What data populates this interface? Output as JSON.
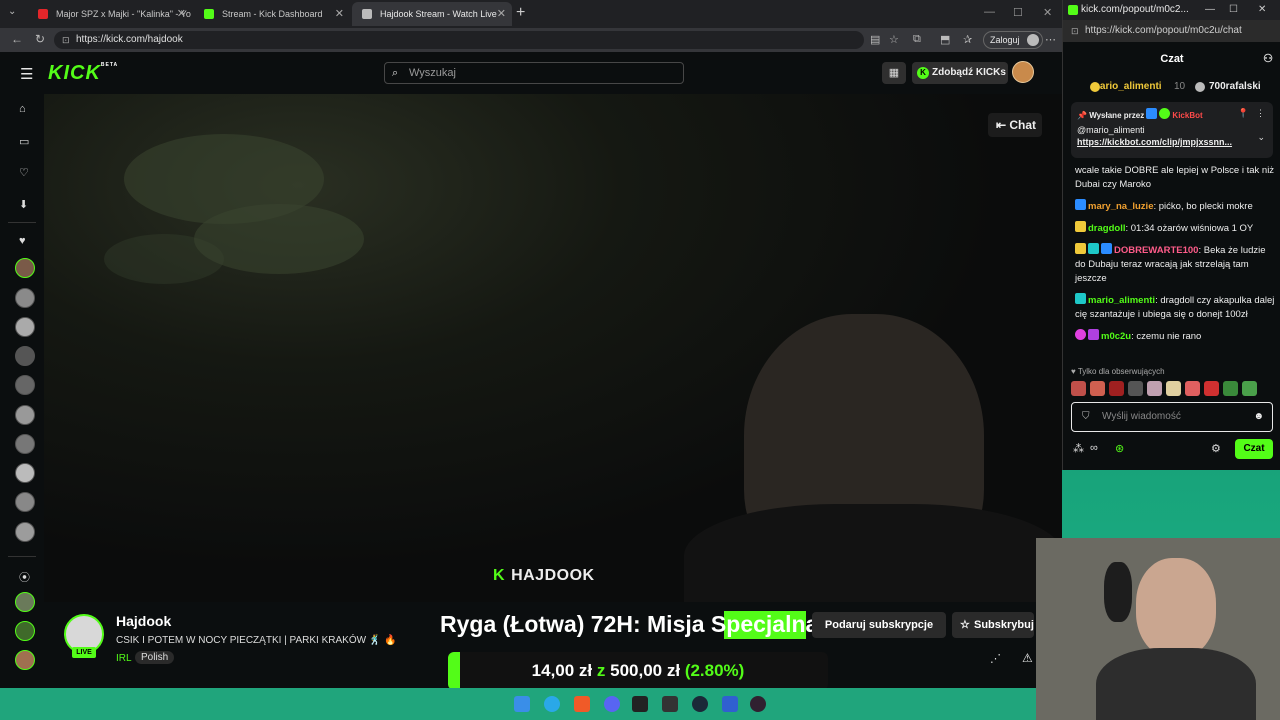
{
  "browser": {
    "tabs": [
      {
        "label": "Major SPZ x Majki - \"Kalinka\" - Yo"
      },
      {
        "label": "Stream - Kick Dashboard"
      },
      {
        "label": "Hajdook Stream - Watch Live"
      }
    ],
    "url": "https://kick.com/hajdook",
    "login_label": "Zaloguj"
  },
  "kick": {
    "logo": "KICK",
    "logo_badge": "BETA",
    "search_placeholder": "Wyszukaj",
    "get_kicks_label": "Zdobądź KICKs"
  },
  "video": {
    "chat_toggle_label": "Chat",
    "watermark": "HAJDOOK"
  },
  "stream": {
    "streamer_name": "Hajdook",
    "live_label": "LIVE",
    "title": "CSIK I POTEM W NOCY PIECZĄTKI | PARKI KRAKÓW 🕺 🔥",
    "category": "IRL",
    "language_tag": "Polish",
    "overlay_title": "Ryga (Łotwa) 72H: Misja Specjalna",
    "gift_sub_label": "Podaruj subskrypcje",
    "subscribe_label": "Subskrybuj"
  },
  "goal": {
    "current": "14,00 zł",
    "z": "z",
    "target": "500,00 zł",
    "percent": "(2.80%)",
    "fraction": 0.028
  },
  "popout": {
    "window_title": "kick.com/popout/m0c2...",
    "url": "https://kick.com/popout/m0c2u/chat",
    "chat_header": "Czat",
    "leaderboard": [
      {
        "name": "mario_alimenti",
        "count": "10"
      },
      {
        "name": "700rafalski",
        "count": ""
      }
    ],
    "pinned": {
      "sent_by_label": "Wysłane przez",
      "bot_name": "KickBot",
      "mention": "@mario_alimenti",
      "link": "https://kickbot.com/clip/jmpjxssnn..."
    },
    "messages": [
      {
        "user": "",
        "color": "#ff5c8a",
        "text": "wcale takie DOBRE ale lepiej w Polsce i tak niż Dubai czy Maroko"
      },
      {
        "user": "mary_na_luzie",
        "color": "#f0a030",
        "text": "pićko, bo plecki mokre"
      },
      {
        "user": "dragdoll",
        "color": "#53fc18",
        "text": "01:34 ożarów wiśniowa 1 OY"
      },
      {
        "user": "DOBREWARTE100",
        "color": "#ff5c8a",
        "text": "Beka że ludzie do Dubaju teraz wracają jak strzelają tam jeszcze"
      },
      {
        "user": "mario_alimenti",
        "color": "#53fc18",
        "text": "dragdoll czy akapulka dalej cię szantażuje i ubiega się o donejt 100zł"
      },
      {
        "user": "m0c2u",
        "color": "#53fc18",
        "text": "czemu nie rano"
      }
    ],
    "followers_only": "Tylko dla obserwujących",
    "input_placeholder": "Wyślij wiadomość",
    "send_label": "Czat"
  },
  "colors": {
    "kick_green": "#53fc18",
    "background": "#0b0e0f",
    "desktop_teal": "#1cb58a"
  }
}
